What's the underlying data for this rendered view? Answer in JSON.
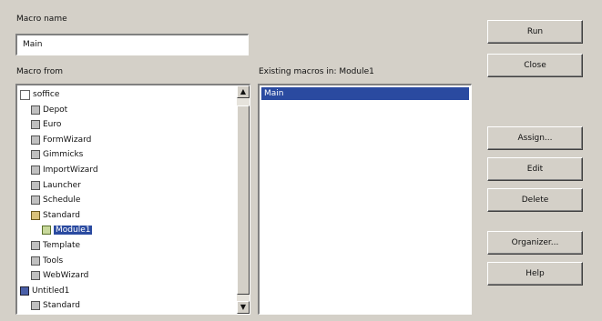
{
  "macro_name": {
    "label": "Macro name",
    "value": "Main"
  },
  "macro_from": {
    "label": "Macro from"
  },
  "existing": {
    "label": "Existing macros in: Module1",
    "items": [
      "Main"
    ]
  },
  "tree": [
    {
      "label": "soffice",
      "icon": "expand-box-icon",
      "level": 0
    },
    {
      "label": "Depot",
      "icon": "library-icon",
      "level": 1
    },
    {
      "label": "Euro",
      "icon": "library-icon",
      "level": 1
    },
    {
      "label": "FormWizard",
      "icon": "library-icon",
      "level": 1
    },
    {
      "label": "Gimmicks",
      "icon": "library-icon",
      "level": 1
    },
    {
      "label": "ImportWizard",
      "icon": "library-icon",
      "level": 1
    },
    {
      "label": "Launcher",
      "icon": "library-icon",
      "level": 1
    },
    {
      "label": "Schedule",
      "icon": "library-icon",
      "level": 1
    },
    {
      "label": "Standard",
      "icon": "library-open-icon",
      "level": 1
    },
    {
      "label": "Module1",
      "icon": "module-icon",
      "level": 2,
      "selected": true
    },
    {
      "label": "Template",
      "icon": "library-icon",
      "level": 1
    },
    {
      "label": "Tools",
      "icon": "library-icon",
      "level": 1
    },
    {
      "label": "WebWizard",
      "icon": "library-icon",
      "level": 1
    },
    {
      "label": "Untitled1",
      "icon": "document-icon",
      "level": 0
    },
    {
      "label": "Standard",
      "icon": "library-icon",
      "level": 1
    }
  ],
  "buttons": {
    "run": "Run",
    "close": "Close",
    "assign": "Assign...",
    "edit": "Edit",
    "delete": "Delete",
    "organizer": "Organizer...",
    "help": "Help"
  }
}
